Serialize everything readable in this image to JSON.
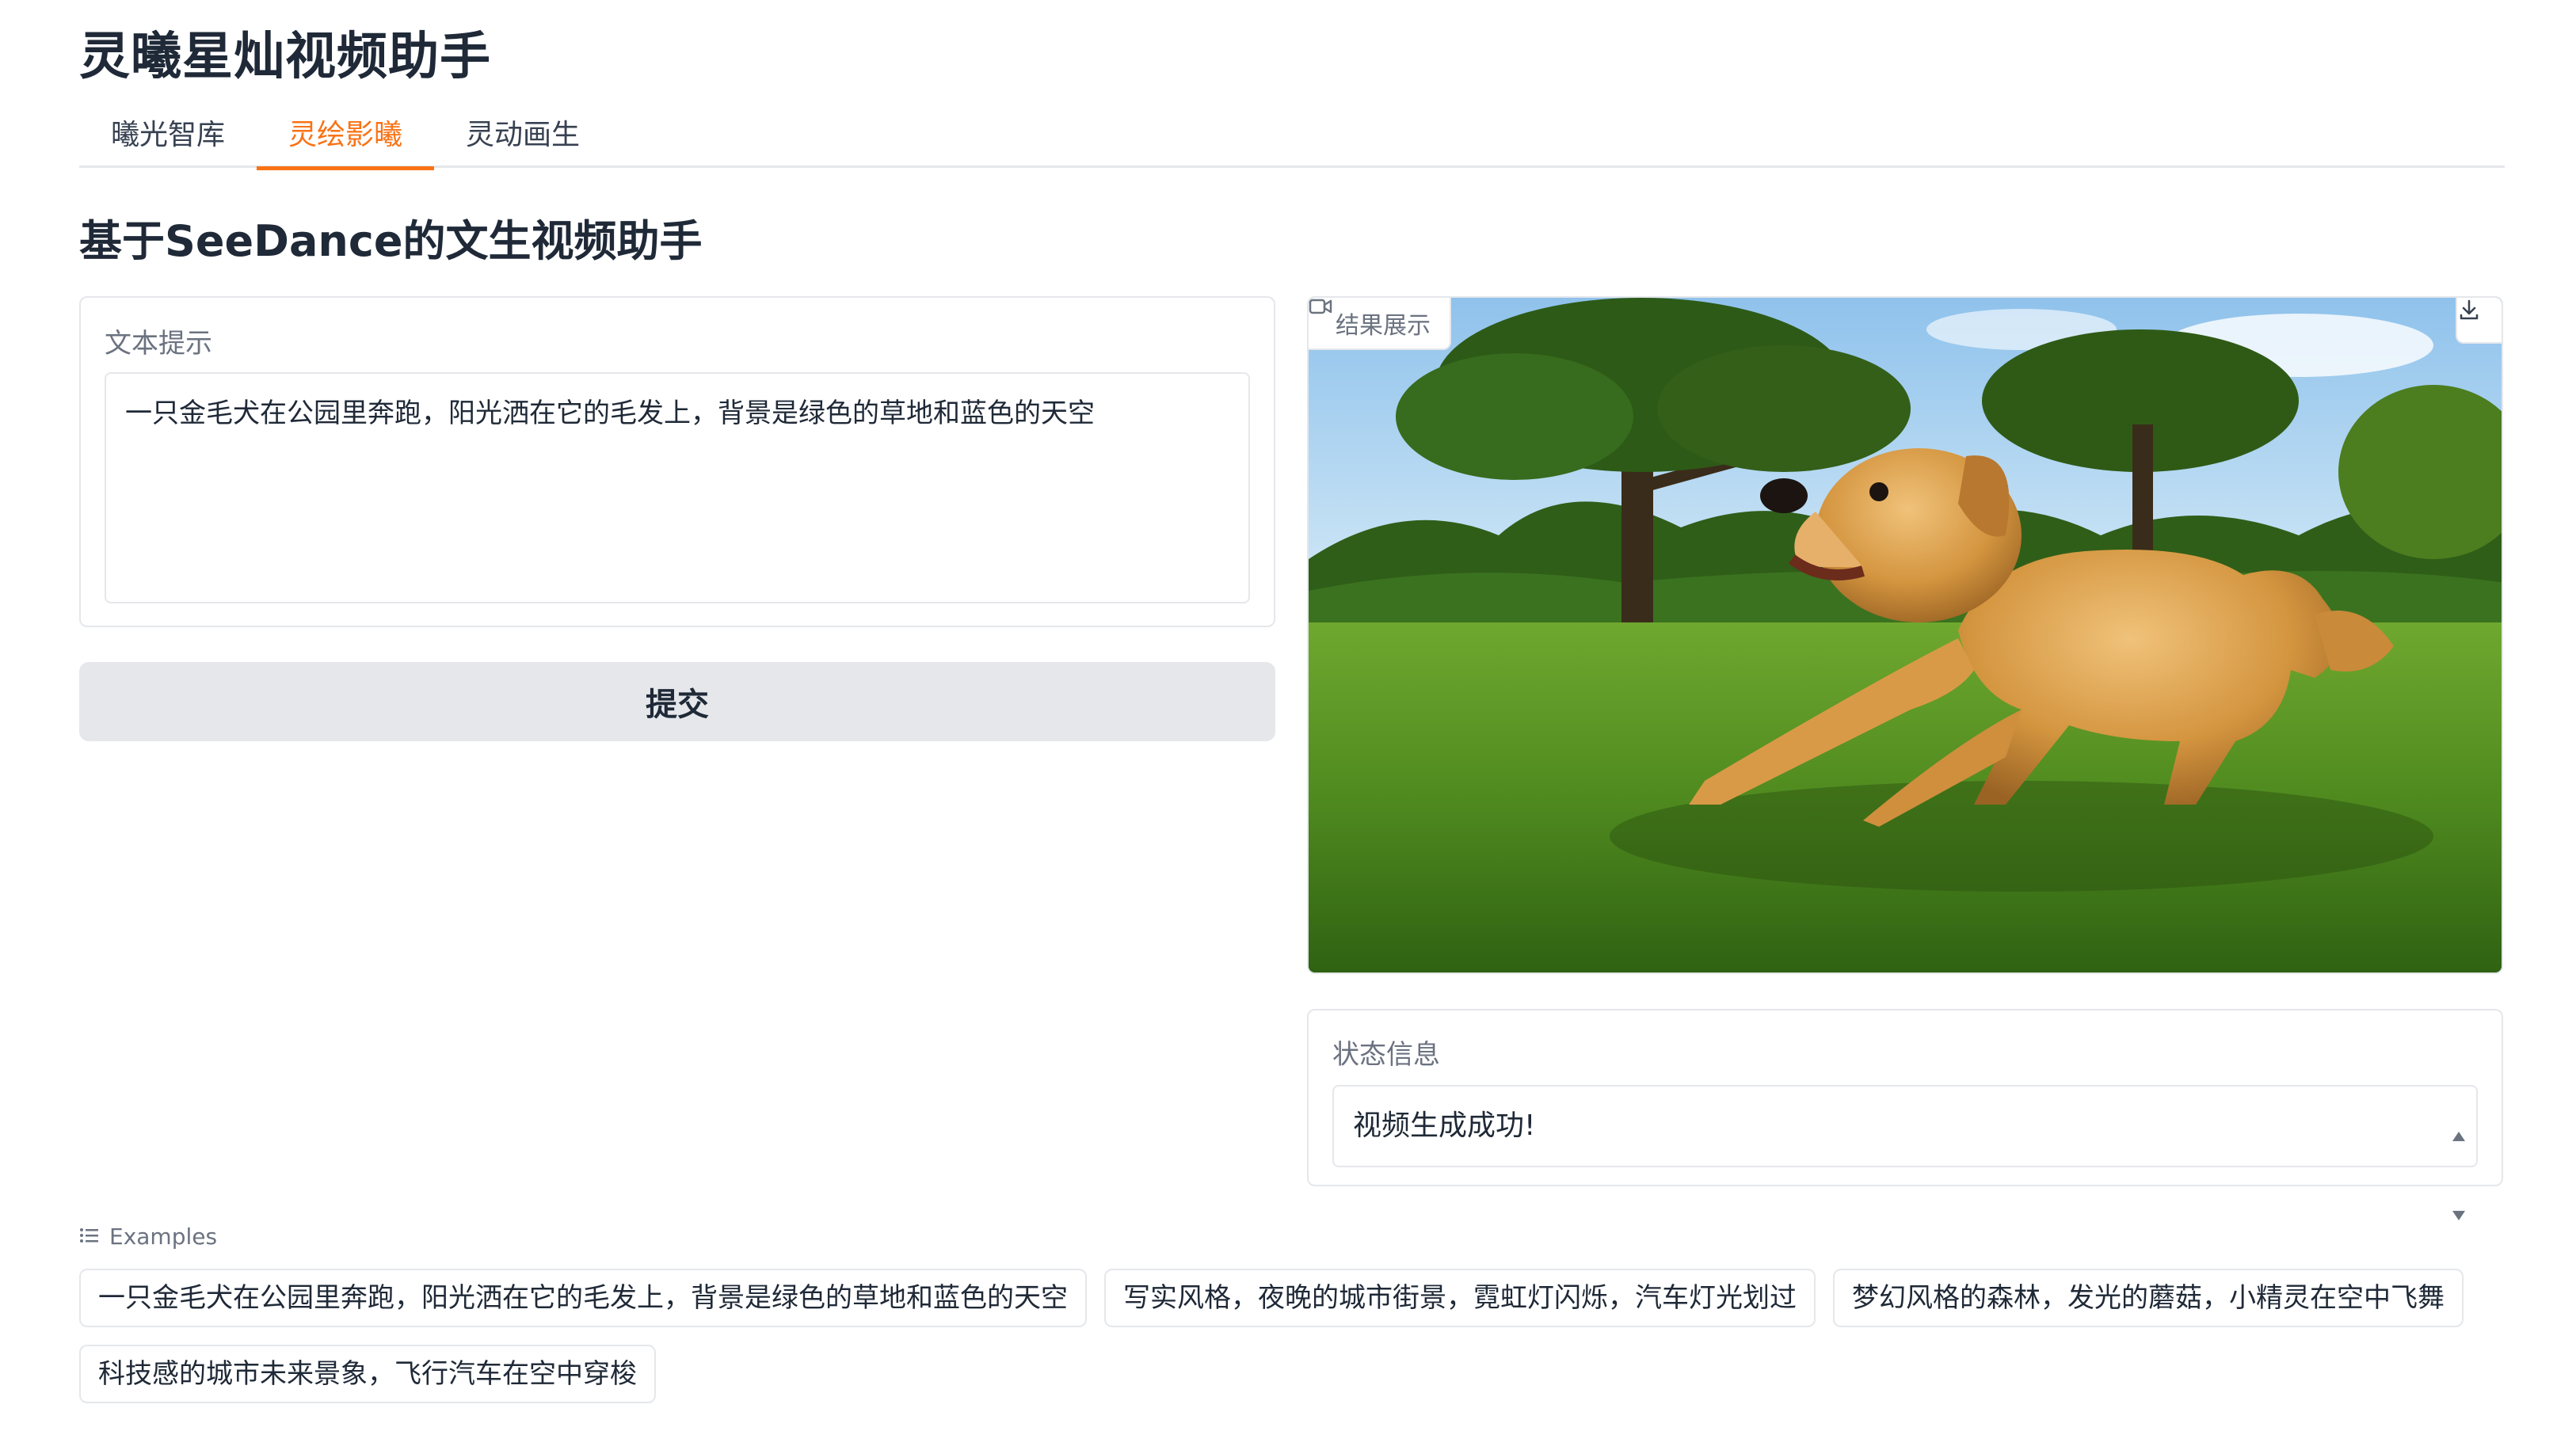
{
  "app": {
    "title": "灵曦星灿视频助手"
  },
  "tabs": [
    {
      "label": "曦光智库",
      "active": false
    },
    {
      "label": "灵绘影曦",
      "active": true
    },
    {
      "label": "灵动画生",
      "active": false
    }
  ],
  "section": {
    "title": "基于SeeDance的文生视频助手"
  },
  "prompt": {
    "label": "文本提示",
    "value": "一只金毛犬在公园里奔跑，阳光洒在它的毛发上，背景是绿色的草地和蓝色的天空"
  },
  "submit": {
    "label": "提交"
  },
  "result": {
    "label": "结果展示",
    "label_icon": "video-camera-icon",
    "download_icon": "download-icon"
  },
  "status": {
    "label": "状态信息",
    "value": "视频生成成功!"
  },
  "examples": {
    "label": "Examples",
    "icon": "list-icon",
    "items": [
      "一只金毛犬在公园里奔跑，阳光洒在它的毛发上，背景是绿色的草地和蓝色的天空",
      "写实风格，夜晚的城市街景，霓虹灯闪烁，汽车灯光划过",
      "梦幻风格的森林，发光的蘑菇，小精灵在空中飞舞",
      "科技感的城市未来景象，飞行汽车在空中穿梭"
    ]
  },
  "colors": {
    "accent": "#f97316",
    "button_bg": "#e5e7eb",
    "border": "#e5e7eb",
    "muted_text": "#6b7280"
  }
}
